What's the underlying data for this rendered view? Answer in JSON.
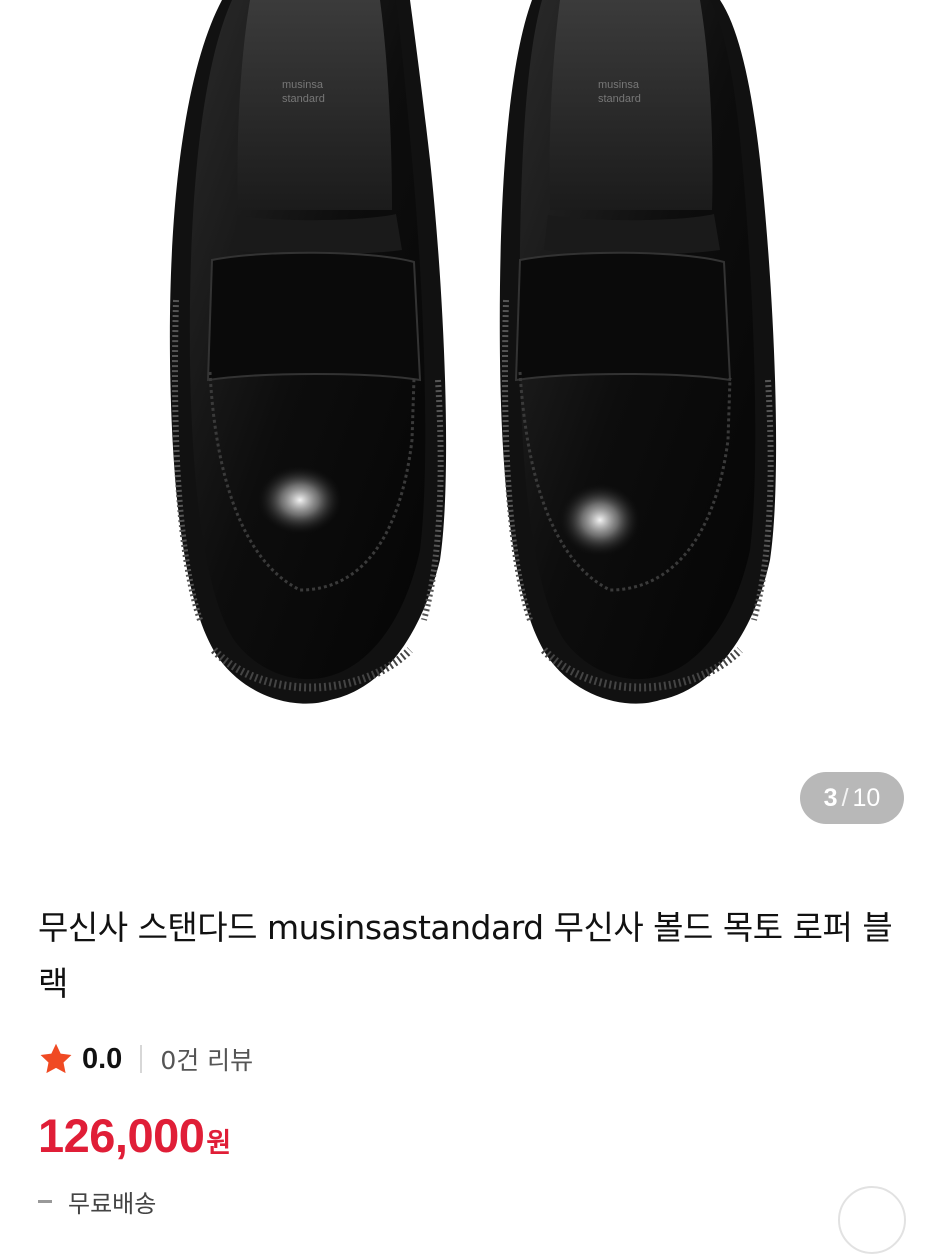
{
  "gallery": {
    "current": "3",
    "separator": "/",
    "total": "10",
    "image_subject": "black penny loafers pair, top view"
  },
  "product": {
    "title": "무신사 스탠다드 musinsastandard 무신사 볼드 목토 로퍼 블랙",
    "rating": "0.0",
    "review_count": "0건 리뷰",
    "price": "126,000",
    "currency": "원",
    "shipping": "무료배송"
  },
  "colors": {
    "price": "#e01e37",
    "star": "#f04a23",
    "counter_bg": "#b8b8b8"
  },
  "icons": {
    "rating": "star-icon"
  }
}
